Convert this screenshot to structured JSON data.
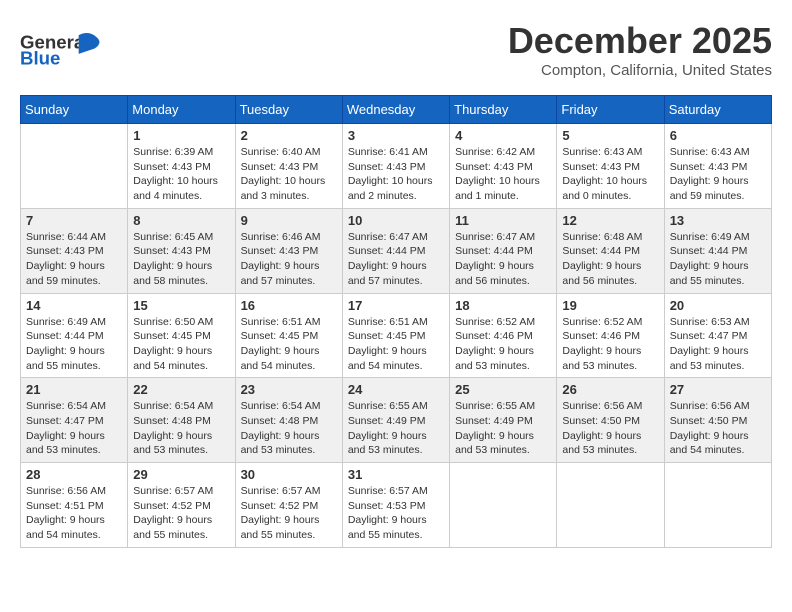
{
  "header": {
    "logo_general": "General",
    "logo_blue": "Blue",
    "month": "December 2025",
    "location": "Compton, California, United States"
  },
  "days_of_week": [
    "Sunday",
    "Monday",
    "Tuesday",
    "Wednesday",
    "Thursday",
    "Friday",
    "Saturday"
  ],
  "weeks": [
    [
      {
        "day": "",
        "info": ""
      },
      {
        "day": "1",
        "info": "Sunrise: 6:39 AM\nSunset: 4:43 PM\nDaylight: 10 hours\nand 4 minutes."
      },
      {
        "day": "2",
        "info": "Sunrise: 6:40 AM\nSunset: 4:43 PM\nDaylight: 10 hours\nand 3 minutes."
      },
      {
        "day": "3",
        "info": "Sunrise: 6:41 AM\nSunset: 4:43 PM\nDaylight: 10 hours\nand 2 minutes."
      },
      {
        "day": "4",
        "info": "Sunrise: 6:42 AM\nSunset: 4:43 PM\nDaylight: 10 hours\nand 1 minute."
      },
      {
        "day": "5",
        "info": "Sunrise: 6:43 AM\nSunset: 4:43 PM\nDaylight: 10 hours\nand 0 minutes."
      },
      {
        "day": "6",
        "info": "Sunrise: 6:43 AM\nSunset: 4:43 PM\nDaylight: 9 hours\nand 59 minutes."
      }
    ],
    [
      {
        "day": "7",
        "info": "Sunrise: 6:44 AM\nSunset: 4:43 PM\nDaylight: 9 hours\nand 59 minutes."
      },
      {
        "day": "8",
        "info": "Sunrise: 6:45 AM\nSunset: 4:43 PM\nDaylight: 9 hours\nand 58 minutes."
      },
      {
        "day": "9",
        "info": "Sunrise: 6:46 AM\nSunset: 4:43 PM\nDaylight: 9 hours\nand 57 minutes."
      },
      {
        "day": "10",
        "info": "Sunrise: 6:47 AM\nSunset: 4:44 PM\nDaylight: 9 hours\nand 57 minutes."
      },
      {
        "day": "11",
        "info": "Sunrise: 6:47 AM\nSunset: 4:44 PM\nDaylight: 9 hours\nand 56 minutes."
      },
      {
        "day": "12",
        "info": "Sunrise: 6:48 AM\nSunset: 4:44 PM\nDaylight: 9 hours\nand 56 minutes."
      },
      {
        "day": "13",
        "info": "Sunrise: 6:49 AM\nSunset: 4:44 PM\nDaylight: 9 hours\nand 55 minutes."
      }
    ],
    [
      {
        "day": "14",
        "info": "Sunrise: 6:49 AM\nSunset: 4:44 PM\nDaylight: 9 hours\nand 55 minutes."
      },
      {
        "day": "15",
        "info": "Sunrise: 6:50 AM\nSunset: 4:45 PM\nDaylight: 9 hours\nand 54 minutes."
      },
      {
        "day": "16",
        "info": "Sunrise: 6:51 AM\nSunset: 4:45 PM\nDaylight: 9 hours\nand 54 minutes."
      },
      {
        "day": "17",
        "info": "Sunrise: 6:51 AM\nSunset: 4:45 PM\nDaylight: 9 hours\nand 54 minutes."
      },
      {
        "day": "18",
        "info": "Sunrise: 6:52 AM\nSunset: 4:46 PM\nDaylight: 9 hours\nand 53 minutes."
      },
      {
        "day": "19",
        "info": "Sunrise: 6:52 AM\nSunset: 4:46 PM\nDaylight: 9 hours\nand 53 minutes."
      },
      {
        "day": "20",
        "info": "Sunrise: 6:53 AM\nSunset: 4:47 PM\nDaylight: 9 hours\nand 53 minutes."
      }
    ],
    [
      {
        "day": "21",
        "info": "Sunrise: 6:54 AM\nSunset: 4:47 PM\nDaylight: 9 hours\nand 53 minutes."
      },
      {
        "day": "22",
        "info": "Sunrise: 6:54 AM\nSunset: 4:48 PM\nDaylight: 9 hours\nand 53 minutes."
      },
      {
        "day": "23",
        "info": "Sunrise: 6:54 AM\nSunset: 4:48 PM\nDaylight: 9 hours\nand 53 minutes."
      },
      {
        "day": "24",
        "info": "Sunrise: 6:55 AM\nSunset: 4:49 PM\nDaylight: 9 hours\nand 53 minutes."
      },
      {
        "day": "25",
        "info": "Sunrise: 6:55 AM\nSunset: 4:49 PM\nDaylight: 9 hours\nand 53 minutes."
      },
      {
        "day": "26",
        "info": "Sunrise: 6:56 AM\nSunset: 4:50 PM\nDaylight: 9 hours\nand 53 minutes."
      },
      {
        "day": "27",
        "info": "Sunrise: 6:56 AM\nSunset: 4:50 PM\nDaylight: 9 hours\nand 54 minutes."
      }
    ],
    [
      {
        "day": "28",
        "info": "Sunrise: 6:56 AM\nSunset: 4:51 PM\nDaylight: 9 hours\nand 54 minutes."
      },
      {
        "day": "29",
        "info": "Sunrise: 6:57 AM\nSunset: 4:52 PM\nDaylight: 9 hours\nand 55 minutes."
      },
      {
        "day": "30",
        "info": "Sunrise: 6:57 AM\nSunset: 4:52 PM\nDaylight: 9 hours\nand 55 minutes."
      },
      {
        "day": "31",
        "info": "Sunrise: 6:57 AM\nSunset: 4:53 PM\nDaylight: 9 hours\nand 55 minutes."
      },
      {
        "day": "",
        "info": ""
      },
      {
        "day": "",
        "info": ""
      },
      {
        "day": "",
        "info": ""
      }
    ]
  ]
}
